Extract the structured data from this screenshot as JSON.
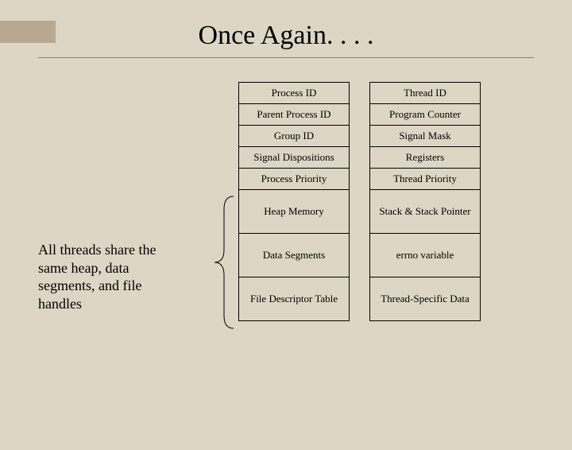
{
  "title": "Once Again. . . .",
  "note": "All threads share the same heap, data segments, and file handles",
  "columns": {
    "process": [
      "Process ID",
      "Parent Process ID",
      "Group ID",
      "Signal Dispositions",
      "Process Priority",
      "Heap Memory",
      "Data Segments",
      "File Descriptor Table"
    ],
    "thread": [
      "Thread ID",
      "Program Counter",
      "Signal Mask",
      "Registers",
      "Thread Priority",
      "Stack & Stack Pointer",
      "errno variable",
      "Thread-Specific Data"
    ]
  }
}
